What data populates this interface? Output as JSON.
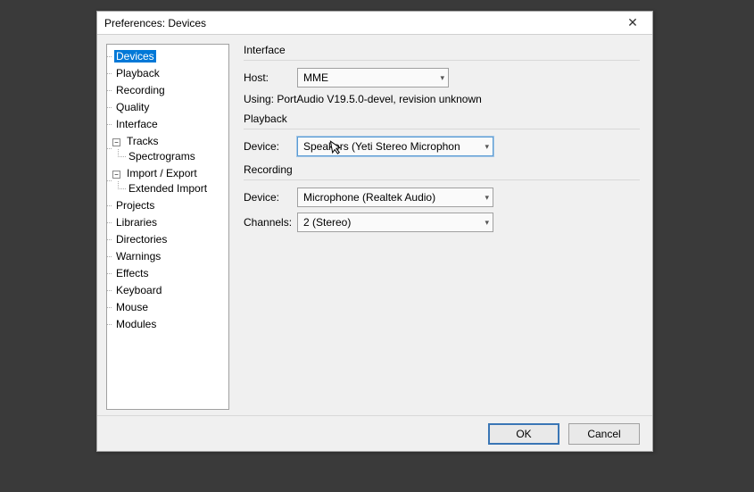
{
  "window": {
    "title": "Preferences: Devices",
    "close_glyph": "✕"
  },
  "tree": {
    "devices": "Devices",
    "playback": "Playback",
    "recording": "Recording",
    "quality": "Quality",
    "interface": "Interface",
    "tracks": "Tracks",
    "spectrograms": "Spectrograms",
    "import_export": "Import / Export",
    "extended_import": "Extended Import",
    "projects": "Projects",
    "libraries": "Libraries",
    "directories": "Directories",
    "warnings": "Warnings",
    "effects": "Effects",
    "keyboard": "Keyboard",
    "mouse": "Mouse",
    "modules": "Modules",
    "expander_minus": "−"
  },
  "interface": {
    "section_title": "Interface",
    "host_label": "Host:",
    "host_value": "MME",
    "using_line": "Using: PortAudio V19.5.0-devel, revision unknown"
  },
  "playback": {
    "section_title": "Playback",
    "device_label": "Device:",
    "device_value": "Speakers (Yeti Stereo Microphon"
  },
  "recording": {
    "section_title": "Recording",
    "device_label": "Device:",
    "device_value": "Microphone (Realtek Audio)",
    "channels_label": "Channels:",
    "channels_value": "2 (Stereo)"
  },
  "buttons": {
    "ok": "OK",
    "cancel": "Cancel"
  },
  "caret": "▾"
}
